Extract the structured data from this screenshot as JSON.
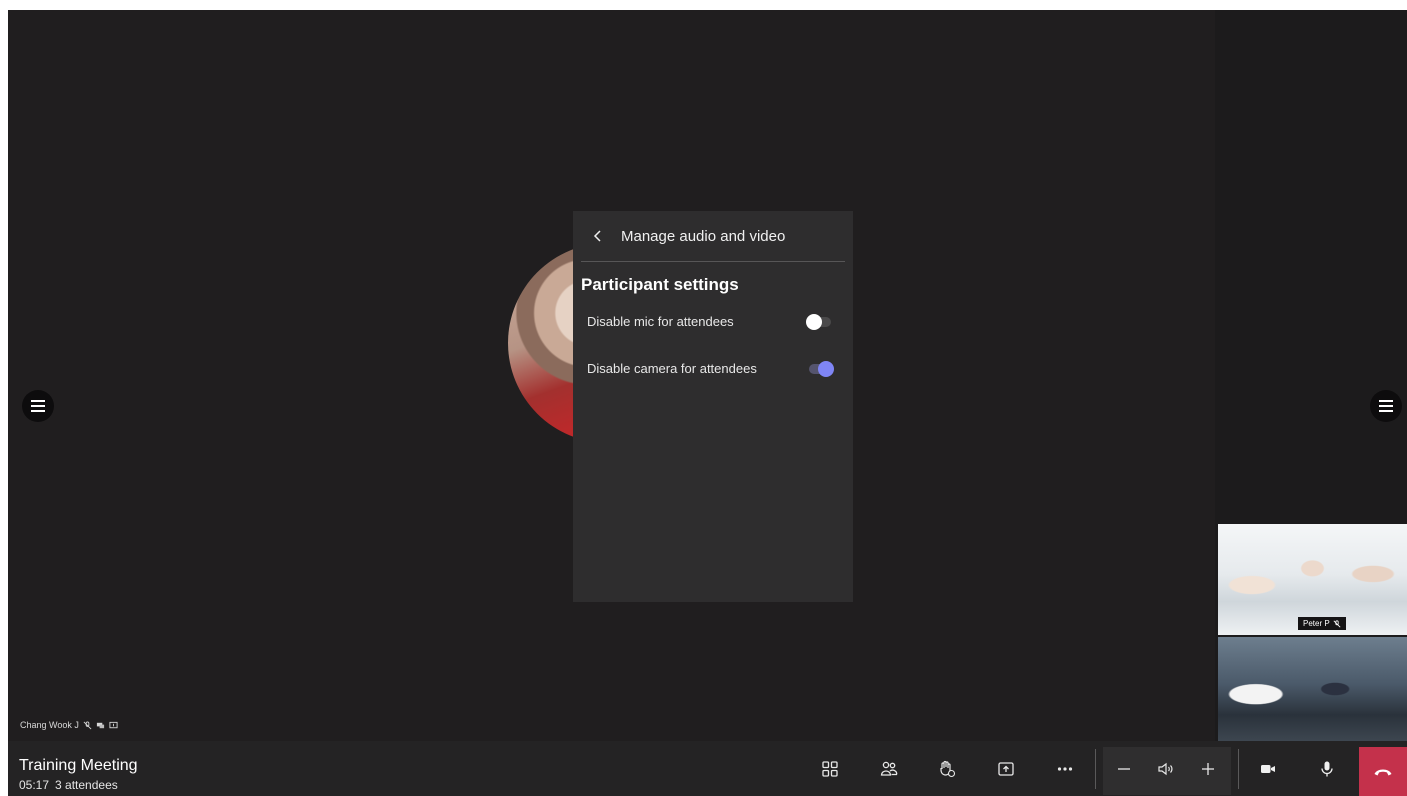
{
  "panel": {
    "title": "Manage audio and video",
    "section_title": "Participant settings",
    "settings": [
      {
        "label": "Disable mic for attendees",
        "enabled": false
      },
      {
        "label": "Disable camera for attendees",
        "enabled": true
      }
    ]
  },
  "main_participant": {
    "name": "Chang Wook J"
  },
  "tiles": [
    {
      "name": "Peter P",
      "muted": true
    },
    {
      "name": "",
      "muted": false
    }
  ],
  "meeting": {
    "title": "Training Meeting",
    "elapsed": "05:17",
    "attendees": "3 attendees"
  },
  "colors": {
    "accent": "#7f85f5",
    "hangup": "#c4314b",
    "stage": "#201e1f"
  },
  "icons": [
    "chevron-left-icon",
    "hamburger-icon",
    "mic-off-icon",
    "chat-icon",
    "share-screen-icon",
    "layout-grid-icon",
    "people-icon",
    "raise-hand-icon",
    "share-icon",
    "more-icon",
    "minus-icon",
    "speaker-icon",
    "plus-icon",
    "camera-icon",
    "mic-icon",
    "hang-up-icon"
  ]
}
